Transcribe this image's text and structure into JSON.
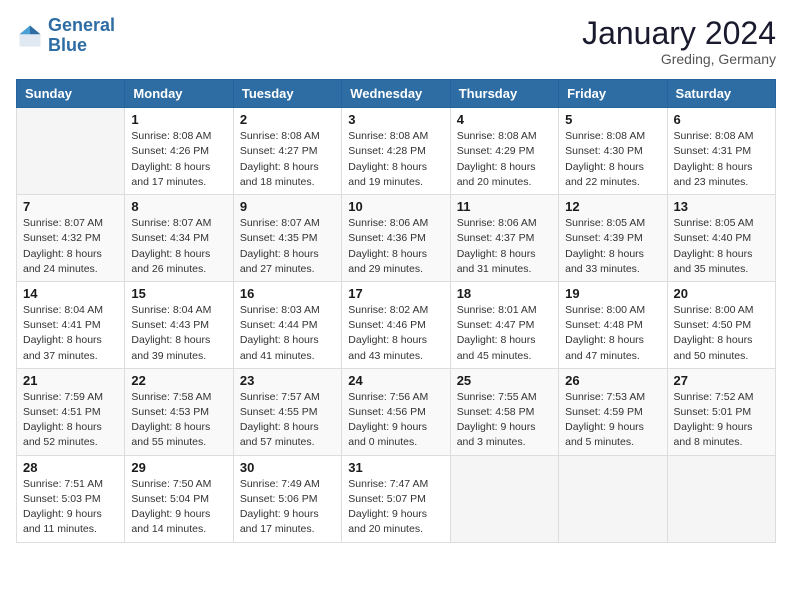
{
  "header": {
    "logo_line1": "General",
    "logo_line2": "Blue",
    "month": "January 2024",
    "location": "Greding, Germany"
  },
  "weekdays": [
    "Sunday",
    "Monday",
    "Tuesday",
    "Wednesday",
    "Thursday",
    "Friday",
    "Saturday"
  ],
  "weeks": [
    [
      {
        "day": "",
        "info": ""
      },
      {
        "day": "1",
        "info": "Sunrise: 8:08 AM\nSunset: 4:26 PM\nDaylight: 8 hours\nand 17 minutes."
      },
      {
        "day": "2",
        "info": "Sunrise: 8:08 AM\nSunset: 4:27 PM\nDaylight: 8 hours\nand 18 minutes."
      },
      {
        "day": "3",
        "info": "Sunrise: 8:08 AM\nSunset: 4:28 PM\nDaylight: 8 hours\nand 19 minutes."
      },
      {
        "day": "4",
        "info": "Sunrise: 8:08 AM\nSunset: 4:29 PM\nDaylight: 8 hours\nand 20 minutes."
      },
      {
        "day": "5",
        "info": "Sunrise: 8:08 AM\nSunset: 4:30 PM\nDaylight: 8 hours\nand 22 minutes."
      },
      {
        "day": "6",
        "info": "Sunrise: 8:08 AM\nSunset: 4:31 PM\nDaylight: 8 hours\nand 23 minutes."
      }
    ],
    [
      {
        "day": "7",
        "info": "Sunrise: 8:07 AM\nSunset: 4:32 PM\nDaylight: 8 hours\nand 24 minutes."
      },
      {
        "day": "8",
        "info": "Sunrise: 8:07 AM\nSunset: 4:34 PM\nDaylight: 8 hours\nand 26 minutes."
      },
      {
        "day": "9",
        "info": "Sunrise: 8:07 AM\nSunset: 4:35 PM\nDaylight: 8 hours\nand 27 minutes."
      },
      {
        "day": "10",
        "info": "Sunrise: 8:06 AM\nSunset: 4:36 PM\nDaylight: 8 hours\nand 29 minutes."
      },
      {
        "day": "11",
        "info": "Sunrise: 8:06 AM\nSunset: 4:37 PM\nDaylight: 8 hours\nand 31 minutes."
      },
      {
        "day": "12",
        "info": "Sunrise: 8:05 AM\nSunset: 4:39 PM\nDaylight: 8 hours\nand 33 minutes."
      },
      {
        "day": "13",
        "info": "Sunrise: 8:05 AM\nSunset: 4:40 PM\nDaylight: 8 hours\nand 35 minutes."
      }
    ],
    [
      {
        "day": "14",
        "info": "Sunrise: 8:04 AM\nSunset: 4:41 PM\nDaylight: 8 hours\nand 37 minutes."
      },
      {
        "day": "15",
        "info": "Sunrise: 8:04 AM\nSunset: 4:43 PM\nDaylight: 8 hours\nand 39 minutes."
      },
      {
        "day": "16",
        "info": "Sunrise: 8:03 AM\nSunset: 4:44 PM\nDaylight: 8 hours\nand 41 minutes."
      },
      {
        "day": "17",
        "info": "Sunrise: 8:02 AM\nSunset: 4:46 PM\nDaylight: 8 hours\nand 43 minutes."
      },
      {
        "day": "18",
        "info": "Sunrise: 8:01 AM\nSunset: 4:47 PM\nDaylight: 8 hours\nand 45 minutes."
      },
      {
        "day": "19",
        "info": "Sunrise: 8:00 AM\nSunset: 4:48 PM\nDaylight: 8 hours\nand 47 minutes."
      },
      {
        "day": "20",
        "info": "Sunrise: 8:00 AM\nSunset: 4:50 PM\nDaylight: 8 hours\nand 50 minutes."
      }
    ],
    [
      {
        "day": "21",
        "info": "Sunrise: 7:59 AM\nSunset: 4:51 PM\nDaylight: 8 hours\nand 52 minutes."
      },
      {
        "day": "22",
        "info": "Sunrise: 7:58 AM\nSunset: 4:53 PM\nDaylight: 8 hours\nand 55 minutes."
      },
      {
        "day": "23",
        "info": "Sunrise: 7:57 AM\nSunset: 4:55 PM\nDaylight: 8 hours\nand 57 minutes."
      },
      {
        "day": "24",
        "info": "Sunrise: 7:56 AM\nSunset: 4:56 PM\nDaylight: 9 hours\nand 0 minutes."
      },
      {
        "day": "25",
        "info": "Sunrise: 7:55 AM\nSunset: 4:58 PM\nDaylight: 9 hours\nand 3 minutes."
      },
      {
        "day": "26",
        "info": "Sunrise: 7:53 AM\nSunset: 4:59 PM\nDaylight: 9 hours\nand 5 minutes."
      },
      {
        "day": "27",
        "info": "Sunrise: 7:52 AM\nSunset: 5:01 PM\nDaylight: 9 hours\nand 8 minutes."
      }
    ],
    [
      {
        "day": "28",
        "info": "Sunrise: 7:51 AM\nSunset: 5:03 PM\nDaylight: 9 hours\nand 11 minutes."
      },
      {
        "day": "29",
        "info": "Sunrise: 7:50 AM\nSunset: 5:04 PM\nDaylight: 9 hours\nand 14 minutes."
      },
      {
        "day": "30",
        "info": "Sunrise: 7:49 AM\nSunset: 5:06 PM\nDaylight: 9 hours\nand 17 minutes."
      },
      {
        "day": "31",
        "info": "Sunrise: 7:47 AM\nSunset: 5:07 PM\nDaylight: 9 hours\nand 20 minutes."
      },
      {
        "day": "",
        "info": ""
      },
      {
        "day": "",
        "info": ""
      },
      {
        "day": "",
        "info": ""
      }
    ]
  ]
}
